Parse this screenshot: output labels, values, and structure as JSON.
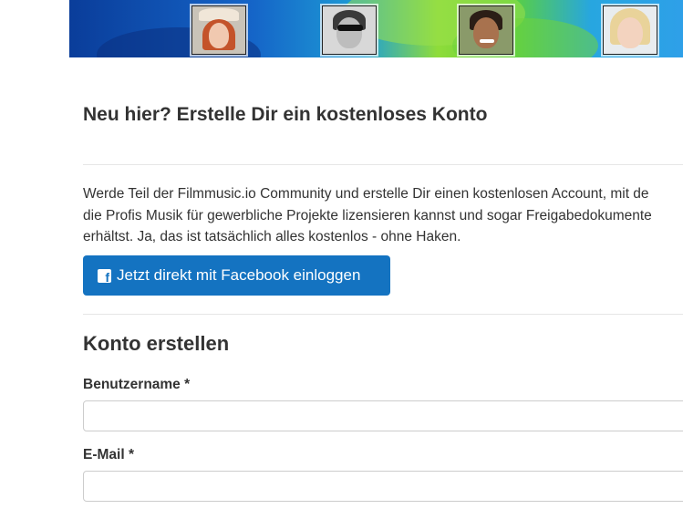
{
  "header": {
    "title": "Neu hier? Erstelle Dir ein kostenloses Konto"
  },
  "intro": {
    "lines": [
      "Werde Teil der Filmmusic.io Community und erstelle Dir einen kostenlosen Account, mit de",
      "die Profis Musik für gewerbliche Projekte lizensieren kannst und sogar Freigabedokumente",
      "erhältst. Ja, das ist tatsächlich alles kostenlos - ohne Haken."
    ]
  },
  "facebook": {
    "label": "Jetzt direkt mit Facebook einloggen",
    "icon": "facebook-icon",
    "color": "#1473c1"
  },
  "form": {
    "title": "Konto erstellen",
    "username": {
      "label": "Benutzername *",
      "value": "",
      "placeholder": ""
    },
    "email": {
      "label": "E-Mail *",
      "value": "",
      "placeholder": ""
    }
  },
  "colors": {
    "text": "#333333",
    "button": "#1473c1",
    "border": "#cccccc"
  }
}
